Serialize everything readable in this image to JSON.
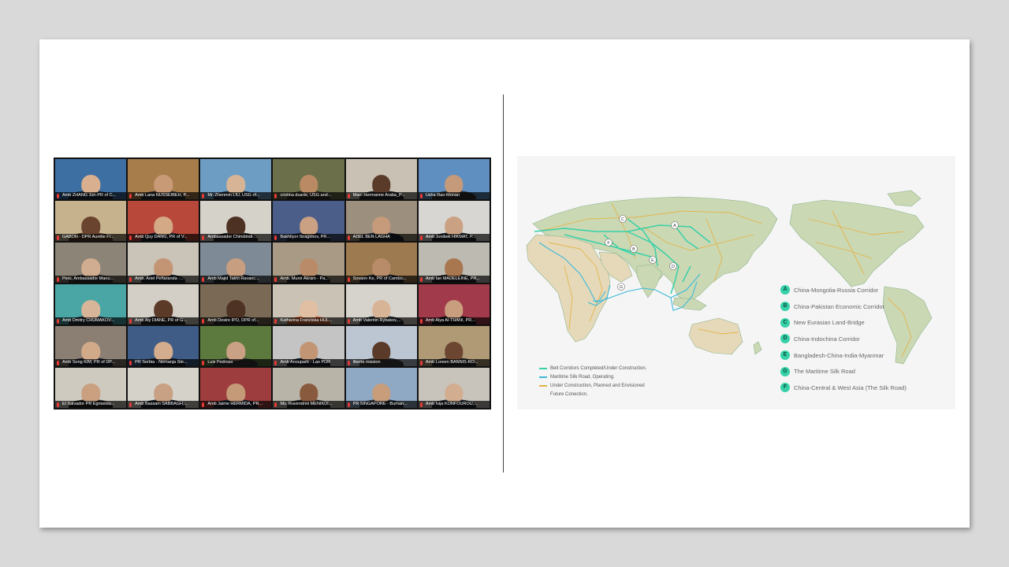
{
  "video_grid": {
    "tiles": [
      {
        "name": "Amb ZHANG Jun-PR of C...",
        "bg": "#3d6fa3",
        "skin": "#d8b08f",
        "suit": "#1f2b3b"
      },
      {
        "name": "Amb Lana NUSSEIBEH, P...",
        "bg": "#a87d4c",
        "skin": "#c99a76",
        "suit": "#2c2c2c"
      },
      {
        "name": "Mr. Zhenmin LIU, USG of...",
        "bg": "#6e9dc4",
        "skin": "#d6b495",
        "suit": "#27313d"
      },
      {
        "name": "cristina duarte, USG and...",
        "bg": "#6b6f4a",
        "skin": "#b98a63",
        "suit": "#3a3326"
      },
      {
        "name": "Marc Hermanne Araba_P...",
        "bg": "#c8c1b4",
        "skin": "#5a3b2a",
        "suit": "#2b2b2b"
      },
      {
        "name": "Usha Rao-Monari",
        "bg": "#5f8fc0",
        "skin": "#c59a7a",
        "suit": "#333"
      },
      {
        "name": "GABON - DPR Aurélie Fl...",
        "bg": "#c6b38d",
        "skin": "#6b4430",
        "suit": "#5a3c2a"
      },
      {
        "name": "Amb Quy DANG, PR of V...",
        "bg": "#b8483a",
        "skin": "#d4a985",
        "suit": "#1c2230"
      },
      {
        "name": "Ambassador Chimbindi-...",
        "bg": "#d5d2c9",
        "skin": "#4d3122",
        "suit": "#2a2a2a"
      },
      {
        "name": "Bakhtiyor Ibragimov, PR...",
        "bg": "#4b5e8a",
        "skin": "#caa183",
        "suit": "#212836"
      },
      {
        "name": "ADEL BEN LAGHA",
        "bg": "#9d8f7d",
        "skin": "#c69b7b",
        "suit": "#262a33"
      },
      {
        "name": "Amb Jonibek HIKMAT, P...",
        "bg": "#d7d6d2",
        "skin": "#caa183",
        "suit": "#22262e"
      },
      {
        "name": "Peru, Ambassador Manu...",
        "bg": "#8c8476",
        "skin": "#d0ad90",
        "suit": "#353535"
      },
      {
        "name": "Amb. Ariel Peñaranda -...",
        "bg": "#c9c3b8",
        "skin": "#c39574",
        "suit": "#1f2530"
      },
      {
        "name": "Amb Majid Takht Ravanc...",
        "bg": "#7e8a95",
        "skin": "#c79e80",
        "suit": "#2a2d33"
      },
      {
        "name": "Amb. Munir Akram - Pa...",
        "bg": "#a89a84",
        "skin": "#b98b69",
        "suit": "#2b2b2b"
      },
      {
        "name": "Sovann Ke, PR of Cambo...",
        "bg": "#9e7a50",
        "skin": "#b88c68",
        "suit": "#1d232d"
      },
      {
        "name": "Amb Ian MADELEINE, PR...",
        "bg": "#bdbab2",
        "skin": "#a8764f",
        "suit": "#2b2b2b"
      },
      {
        "name": "Amb Dmitry CHUMAKOV...",
        "bg": "#4aa6a5",
        "skin": "#d7b598",
        "suit": "#2c3440"
      },
      {
        "name": "Amb Aly DIANE, PR of G...",
        "bg": "#d3cfc6",
        "skin": "#5b3b28",
        "suit": "#2a2a2a"
      },
      {
        "name": "Amb Desire IPO, DPR of...",
        "bg": "#7a6a55",
        "skin": "#4e3223",
        "suit": "#2d2d2d"
      },
      {
        "name": "Katharina Franziska HUL...",
        "bg": "#c9c2b5",
        "skin": "#e0bfa2",
        "suit": "#d46a3d"
      },
      {
        "name": "Amb Valentin Rybakov,...",
        "bg": "#d6d3cc",
        "skin": "#d8b497",
        "suit": "#2a2f38"
      },
      {
        "name": "Amb Alya Al-THANI, PR...",
        "bg": "#a13a4a",
        "skin": "#c89e7f",
        "suit": "#151515"
      },
      {
        "name": "Amb Song KIM, PR of DP...",
        "bg": "#8a7f72",
        "skin": "#d1aa8a",
        "suit": "#232833"
      },
      {
        "name": "PR Serbia - Nemanja Ste...",
        "bg": "#3e5c85",
        "skin": "#d3ad8e",
        "suit": "#1d2430"
      },
      {
        "name": "Luis Pedroso",
        "bg": "#5c7a3d",
        "skin": "#caa184",
        "suit": "#3b3b3b"
      },
      {
        "name": "Amb Anouparb - Lao PDR",
        "bg": "#c4c4c4",
        "skin": "#c29675",
        "suit": "#1e2633"
      },
      {
        "name": "liberia mission",
        "bg": "#bcc6d3",
        "skin": "#5a3a28",
        "suit": "#444"
      },
      {
        "name": "Amb Loreen BANNIS-RO...",
        "bg": "#b09a76",
        "skin": "#6d4632",
        "suit": "#2f2f2f"
      },
      {
        "name": "El Salvador PR Egriselda...",
        "bg": "#cfcac0",
        "skin": "#caa080",
        "suit": "#262626"
      },
      {
        "name": "Amb Bassam SABBAGH,...",
        "bg": "#d5d2ca",
        "skin": "#c8a083",
        "suit": "#1f2530"
      },
      {
        "name": "Amb Jaime HERMIDA, PR...",
        "bg": "#9e3d3d",
        "skin": "#c49a79",
        "suit": "#1e2632"
      },
      {
        "name": "Ms. Ruvendrini MENIKDI...",
        "bg": "#b9b4a8",
        "skin": "#8a5a3e",
        "suit": "#2c2c2c"
      },
      {
        "name": "PR SINGAPORE - Burhan...",
        "bg": "#8fa8c4",
        "skin": "#c79d7c",
        "suit": "#2b303a"
      },
      {
        "name": "Amb Ivija KONFOUROU,...",
        "bg": "#c8c4bc",
        "skin": "#d3ad8f",
        "suit": "#1f2530"
      }
    ]
  },
  "map": {
    "colors": {
      "land": "#cbd8b4",
      "land_dark": "#8fb38d",
      "desert": "#e6d9b9",
      "ocean": "#f4f5f4",
      "corridor_green": "#36d1a8",
      "maritime_blue": "#3cb9d9",
      "planned_orange": "#e3b44a"
    },
    "markers": [
      "A",
      "B",
      "C",
      "D",
      "E",
      "F",
      "G"
    ],
    "legend_bottom": [
      {
        "label": "Belt Corridors Completed/Under Construction.",
        "color": "#36d1a8"
      },
      {
        "label": "Maritime Silk Road, Operating.",
        "color": "#3cb9d9"
      },
      {
        "label": "Under Construction, Planned and Envisioned",
        "color": "#e3b44a"
      },
      {
        "label": "Future Conection.",
        "color": ""
      }
    ],
    "legend_right": [
      {
        "letter": "A",
        "label": "China-Mongolia-Russia Corridor"
      },
      {
        "letter": "B",
        "label": "China-Pakistan Economic Corridor"
      },
      {
        "letter": "C",
        "label": "New Eurasian Land-Bridge"
      },
      {
        "letter": "D",
        "label": "China-Indochina Corridor"
      },
      {
        "letter": "E",
        "label": "Bangladesh-China-India-Myanmar"
      },
      {
        "letter": "G",
        "label": "The Maritime Silk Road"
      },
      {
        "letter": "F",
        "label": "China-Central & West Asia (The Silk Road)"
      }
    ]
  }
}
